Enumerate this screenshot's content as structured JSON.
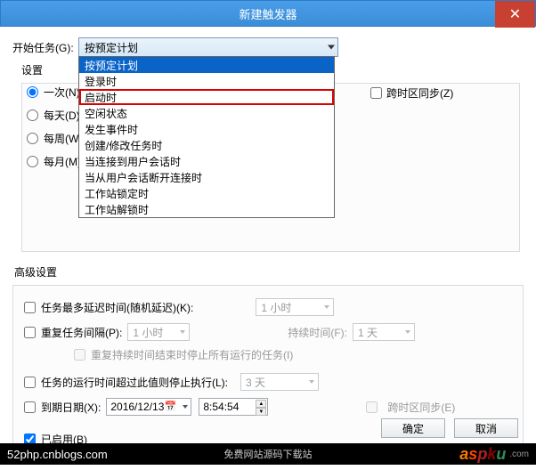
{
  "title": "新建触发器",
  "labels": {
    "start_task": "开始任务(G):",
    "settings": "设置",
    "advanced": "高级设置"
  },
  "dropdown": {
    "selected": "按预定计划",
    "items": [
      "按预定计划",
      "登录时",
      "启动时",
      "空闲状态",
      "发生事件时",
      "创建/修改任务时",
      "当连接到用户会话时",
      "当从用户会话断开连接时",
      "工作站锁定时",
      "工作站解锁时"
    ]
  },
  "schedule": {
    "once": "一次(N)",
    "daily": "每天(D)",
    "weekly": "每周(W)",
    "monthly": "每月(M)"
  },
  "sync_tz": "跨时区同步(Z)",
  "adv": {
    "delay": "任务最多延迟时间(随机延迟)(K):",
    "delay_val": "1 小时",
    "repeat": "重复任务间隔(P):",
    "repeat_val": "1 小时",
    "duration_lbl": "持续时间(F):",
    "duration_val": "1 天",
    "stop_at_end": "重复持续时间结束时停止所有运行的任务(I)",
    "stop_after": "任务的运行时间超过此值则停止执行(L):",
    "stop_after_val": "3 天",
    "expire": "到期日期(X):",
    "expire_date": "2016/12/13",
    "expire_time": "8:54:54",
    "expire_sync": "跨时区同步(E)",
    "enabled": "已启用(B)"
  },
  "buttons": {
    "ok": "确定",
    "cancel": "取消"
  },
  "footer": {
    "left": "52php.cnblogs.com",
    "center": "免费网站源码下载站"
  }
}
